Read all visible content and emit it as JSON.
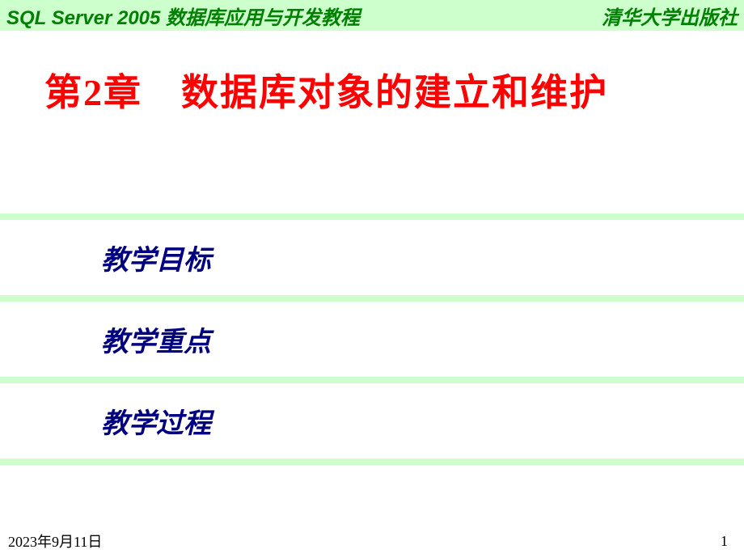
{
  "header": {
    "left": "SQL Server 2005 数据库应用与开发教程",
    "right": "清华大学出版社"
  },
  "chapter_title": "第2章　数据库对象的建立和维护",
  "sections": [
    "教学目标",
    "教学重点",
    "教学过程"
  ],
  "footer": {
    "date": "2023年9月11日",
    "page_number": "1"
  }
}
